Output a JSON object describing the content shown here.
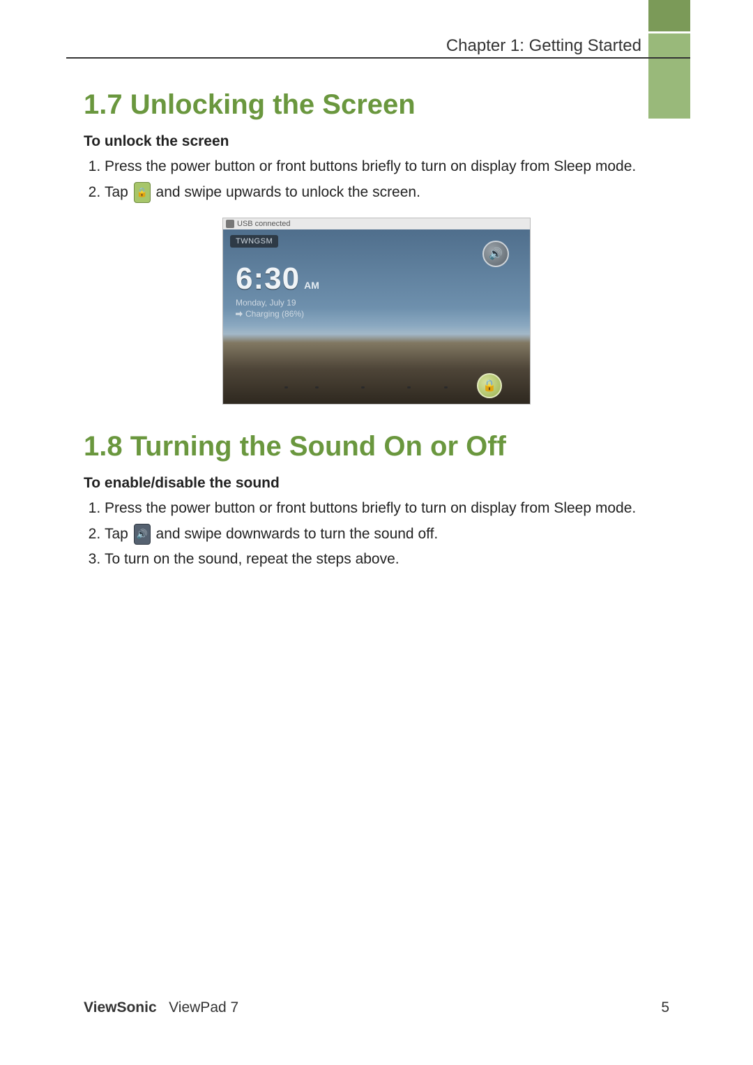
{
  "header": {
    "chapter_label": "Chapter 1: Getting Started"
  },
  "section_1_7": {
    "heading": "1.7 Unlocking the Screen",
    "sub_heading": "To unlock the screen",
    "step1": "Press the power button or front buttons briefly to turn on display from Sleep mode.",
    "step2_a": "Tap",
    "step2_b": "and swipe upwards to unlock the screen."
  },
  "lockscreen": {
    "status_text": "USB connected",
    "carrier": "TWNGSM",
    "time": "6:30",
    "ampm": "AM",
    "date": "Monday, July 19",
    "charging": "Charging (86%)"
  },
  "section_1_8": {
    "heading": "1.8 Turning the Sound On or Off",
    "sub_heading": "To enable/disable the sound",
    "step1": "Press the power button or front buttons briefly to turn on display from Sleep mode.",
    "step2_a": "Tap",
    "step2_b": "and swipe downwards to turn the sound off.",
    "step3": "To turn on the sound, repeat the steps above."
  },
  "footer": {
    "brand_bold": "ViewSonic",
    "brand_rest": "ViewPad 7",
    "page_number": "5"
  },
  "icons": {
    "lock_glyph": "🔒",
    "sound_glyph": "🔊",
    "speaker_glyph": "🔊"
  }
}
